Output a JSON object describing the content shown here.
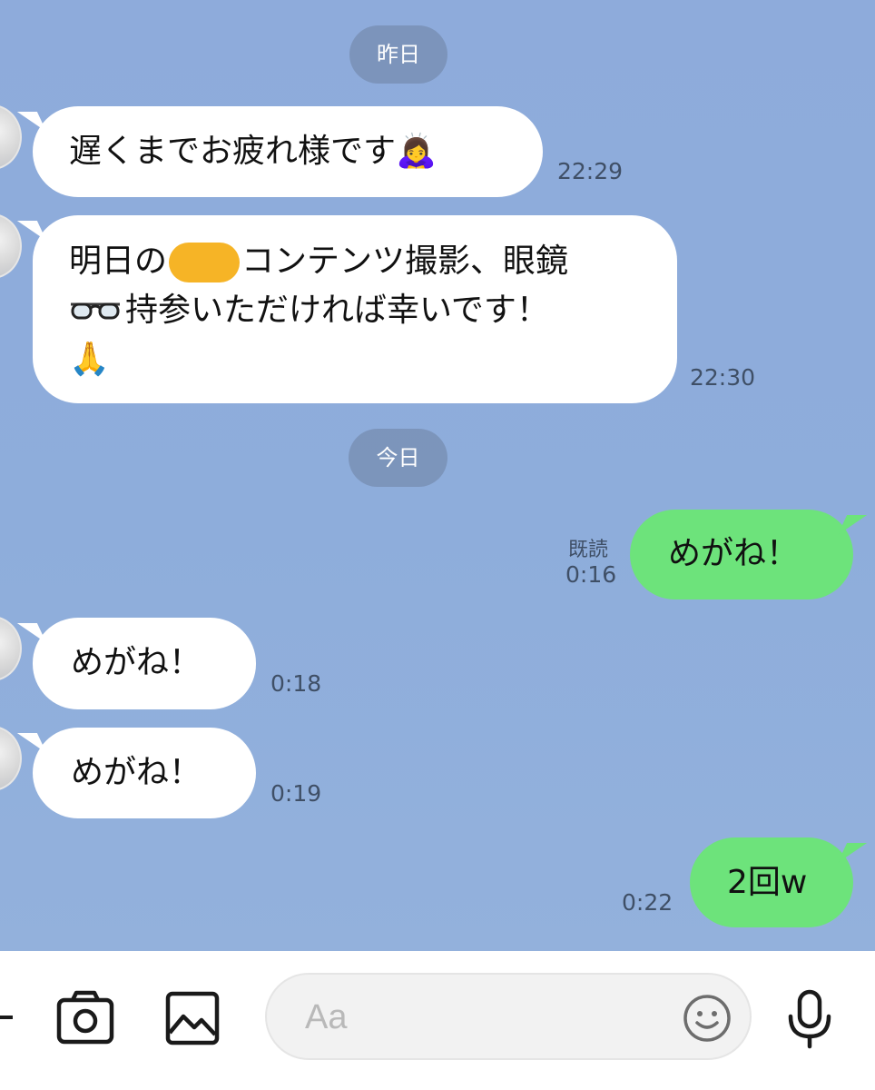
{
  "dates": {
    "yesterday": "昨日",
    "today": "今日"
  },
  "messages": [
    {
      "sender": "other",
      "lines": [
        "遅くまでお疲れ様です"
      ],
      "emoji": "🙇‍♀️",
      "time": "22:29"
    },
    {
      "sender": "other",
      "line1_before": "明日の",
      "line1_after": "コンテンツ撮影、眼鏡",
      "line2": "持参いただければ幸いです！",
      "line3_emoji": "🙏",
      "glasses_emoji": "👓",
      "time": "22:30"
    },
    {
      "sender": "me",
      "text": "めがね！",
      "read": "既読",
      "time": "0:16"
    },
    {
      "sender": "other",
      "text": "めがね！",
      "time": "0:18"
    },
    {
      "sender": "other",
      "text": "めがね！",
      "time": "0:19"
    },
    {
      "sender": "me",
      "text": "2回w",
      "time": "0:22"
    }
  ],
  "input": {
    "placeholder": "Aa"
  },
  "toolbar_icons": [
    "plus-icon",
    "camera-icon",
    "image-icon",
    "smiley-icon",
    "microphone-icon"
  ],
  "colors": {
    "background": "#8facd9",
    "bubble_in": "#ffffff",
    "bubble_out": "#6de37b",
    "redaction": "#f6b426"
  }
}
